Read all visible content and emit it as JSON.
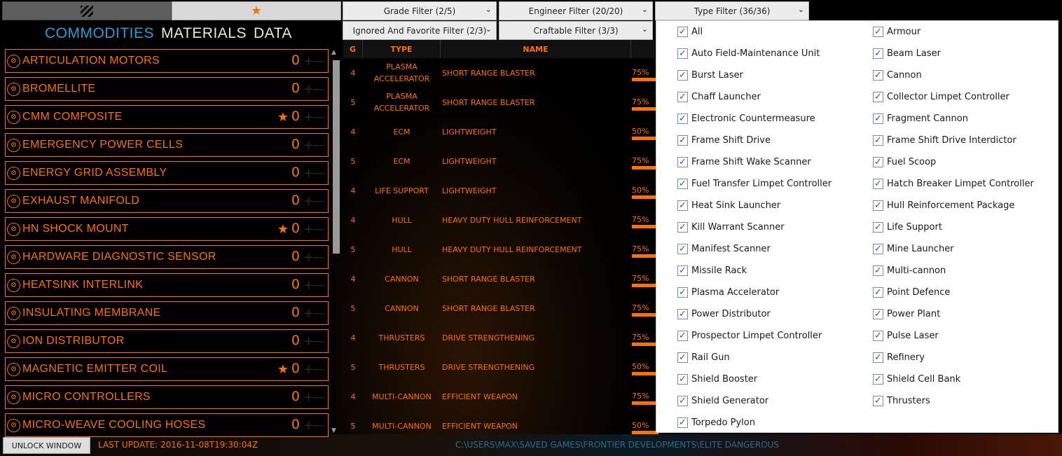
{
  "top_tabs": [
    {
      "icon": "hatch-icon",
      "label": "",
      "active": true
    },
    {
      "icon": "star-icon",
      "label": "★",
      "active": false
    }
  ],
  "section_tabs": [
    "COMMODITIES",
    "MATERIALS",
    "DATA"
  ],
  "active_section": "COMMODITIES",
  "filters": {
    "grade": "Grade Filter (2/5)",
    "engineer": "Engineer Filter (20/20)",
    "type": "Type Filter (36/36)",
    "ignored_favorite": "Ignored And Favorite Filter (2/3)",
    "craftable": "Craftable Filter (3/3)"
  },
  "commodities": [
    {
      "name": "ARTICULATION MOTORS",
      "count": "0",
      "favorite": false
    },
    {
      "name": "BROMELLITE",
      "count": "0",
      "favorite": false
    },
    {
      "name": "CMM COMPOSITE",
      "count": "0",
      "favorite": true
    },
    {
      "name": "EMERGENCY POWER CELLS",
      "count": "0",
      "favorite": false
    },
    {
      "name": "ENERGY GRID ASSEMBLY",
      "count": "0",
      "favorite": false
    },
    {
      "name": "EXHAUST MANIFOLD",
      "count": "0",
      "favorite": false
    },
    {
      "name": "HN SHOCK MOUNT",
      "count": "0",
      "favorite": true
    },
    {
      "name": "HARDWARE DIAGNOSTIC SENSOR",
      "count": "0",
      "favorite": false
    },
    {
      "name": "HEATSINK INTERLINK",
      "count": "0",
      "favorite": false
    },
    {
      "name": "INSULATING MEMBRANE",
      "count": "0",
      "favorite": false
    },
    {
      "name": "ION DISTRIBUTOR",
      "count": "0",
      "favorite": false
    },
    {
      "name": "MAGNETIC EMITTER COIL",
      "count": "0",
      "favorite": true
    },
    {
      "name": "MICRO CONTROLLERS",
      "count": "0",
      "favorite": false
    },
    {
      "name": "MICRO-WEAVE COOLING HOSES",
      "count": "0",
      "favorite": false
    }
  ],
  "table": {
    "headers": [
      "G",
      "TYPE",
      "NAME"
    ],
    "rows": [
      {
        "g": "4",
        "type": "PLASMA ACCELERATOR",
        "name": "SHORT RANGE BLASTER",
        "progress": "75%"
      },
      {
        "g": "5",
        "type": "PLASMA ACCELERATOR",
        "name": "SHORT RANGE BLASTER",
        "progress": "75%"
      },
      {
        "g": "4",
        "type": "ECM",
        "name": "LIGHTWEIGHT",
        "progress": "50%"
      },
      {
        "g": "5",
        "type": "ECM",
        "name": "LIGHTWEIGHT",
        "progress": "75%"
      },
      {
        "g": "4",
        "type": "LIFE SUPPORT",
        "name": "LIGHTWEIGHT",
        "progress": "50%"
      },
      {
        "g": "4",
        "type": "HULL",
        "name": "HEAVY DUTY HULL REINFORCEMENT",
        "progress": "75%"
      },
      {
        "g": "5",
        "type": "HULL",
        "name": "HEAVY DUTY HULL REINFORCEMENT",
        "progress": "75%"
      },
      {
        "g": "4",
        "type": "CANNON",
        "name": "SHORT RANGE BLASTER",
        "progress": "75%"
      },
      {
        "g": "5",
        "type": "CANNON",
        "name": "SHORT RANGE BLASTER",
        "progress": "75%"
      },
      {
        "g": "4",
        "type": "THRUSTERS",
        "name": "DRIVE STRENGTHENING",
        "progress": "75%"
      },
      {
        "g": "5",
        "type": "THRUSTERS",
        "name": "DRIVE STRENGTHENING",
        "progress": "50%"
      },
      {
        "g": "4",
        "type": "MULTI-CANNON",
        "name": "EFFICIENT WEAPON",
        "progress": "75%"
      },
      {
        "g": "5",
        "type": "MULTI-CANNON",
        "name": "EFFICIENT WEAPON",
        "progress": "50%"
      }
    ]
  },
  "type_filter_options": {
    "left": [
      "All",
      "Auto Field-Maintenance Unit",
      "Burst Laser",
      "Chaff Launcher",
      "Electronic Countermeasure",
      "Frame Shift Drive",
      "Frame Shift Wake Scanner",
      "Fuel Transfer Limpet Controller",
      "Heat Sink Launcher",
      "Kill Warrant Scanner",
      "Manifest Scanner",
      "Missile Rack",
      "Plasma Accelerator",
      "Power Distributor",
      "Prospector Limpet Controller",
      "Rail Gun",
      "Shield Booster",
      "Shield Generator",
      "Torpedo Pylon"
    ],
    "right": [
      "Armour",
      "Beam Laser",
      "Cannon",
      "Collector Limpet Controller",
      "Fragment Cannon",
      "Frame Shift Drive Interdictor",
      "Fuel Scoop",
      "Hatch Breaker Limpet Controller",
      "Hull Reinforcement Package",
      "Life Support",
      "Mine Launcher",
      "Multi-cannon",
      "Point Defence",
      "Power Plant",
      "Pulse Laser",
      "Refinery",
      "Shield Cell Bank",
      "Thrusters"
    ],
    "all_checked": true
  },
  "status": {
    "unlock_button": "UNLOCK WINDOW",
    "last_update": "LAST UPDATE:  2016-11-08T19:30:04Z",
    "path": "C:\\USERS\\MAX\\SAVED GAMES\\FRONTIER DEVELOPMENTS\\ELITE DANGEROUS"
  },
  "colors": {
    "accent": "#ff7100",
    "active_tab": "#2a9ed8",
    "checkbox": "#1f5fae"
  }
}
